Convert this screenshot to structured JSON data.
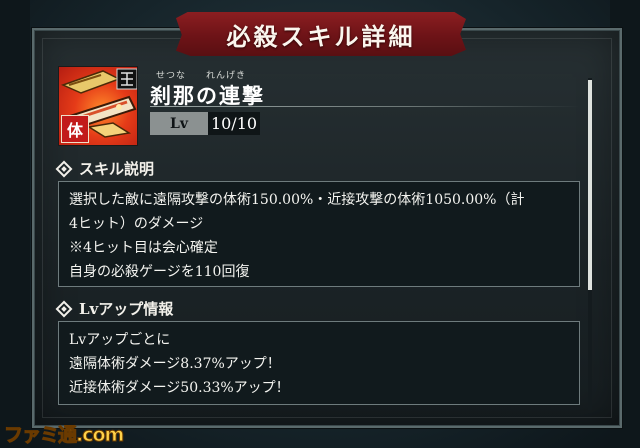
{
  "dialog": {
    "title": "必殺スキル詳細"
  },
  "skill": {
    "name": "刹那の連撃",
    "ruby_setsuna": "せつな",
    "ruby_rengeki": "れんげき",
    "badge": "体",
    "level": {
      "label": "Lv",
      "current": "10",
      "separator": "/",
      "max": "10"
    }
  },
  "description": {
    "heading": "スキル説明",
    "lines": [
      "選択した敵に遠隔攻撃の体術150.00%・近接攻撃の体術1050.00%（計",
      "4ヒット）のダメージ",
      "※4ヒット目は会心確定",
      "自身の必殺ゲージを110回復"
    ]
  },
  "levelup": {
    "heading": "Lvアップ情報",
    "lines": [
      "Lvアップごとに",
      "遠隔体術ダメージ8.37%アップ！",
      "近接体術ダメージ50.33%アップ！"
    ]
  },
  "watermark": {
    "text": "ファミ通.com"
  },
  "colors": {
    "banner": "#7a171b",
    "accent_gold": "#ffd24a"
  }
}
